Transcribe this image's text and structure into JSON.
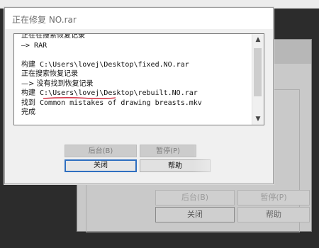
{
  "dialog": {
    "title": "正在修复 NO.rar"
  },
  "log": {
    "lines": [
      "正在在搜索恢复记录",
      "—> RAR",
      "",
      "构建 C:\\Users\\lovej\\Desktop\\fixed.NO.rar",
      "正在搜索恢复记录",
      "—> 没有找到恢复记录",
      "构建 C:\\Users\\lovej\\Desktop\\rebuilt.NO.rar",
      "找到 Common mistakes of drawing breasts.mkv",
      "完成"
    ]
  },
  "buttons": {
    "background": "后台(B)",
    "pause": "暂停(P)",
    "close": "关闭",
    "help": "帮助"
  },
  "background_window": {
    "buttons": {
      "background": "后台(B)",
      "pause": "暂停(P)",
      "close": "关闭",
      "help": "帮助"
    }
  },
  "colors": {
    "annotation_underline": "#d4384a",
    "default_button_border": "#2f6fc0"
  }
}
